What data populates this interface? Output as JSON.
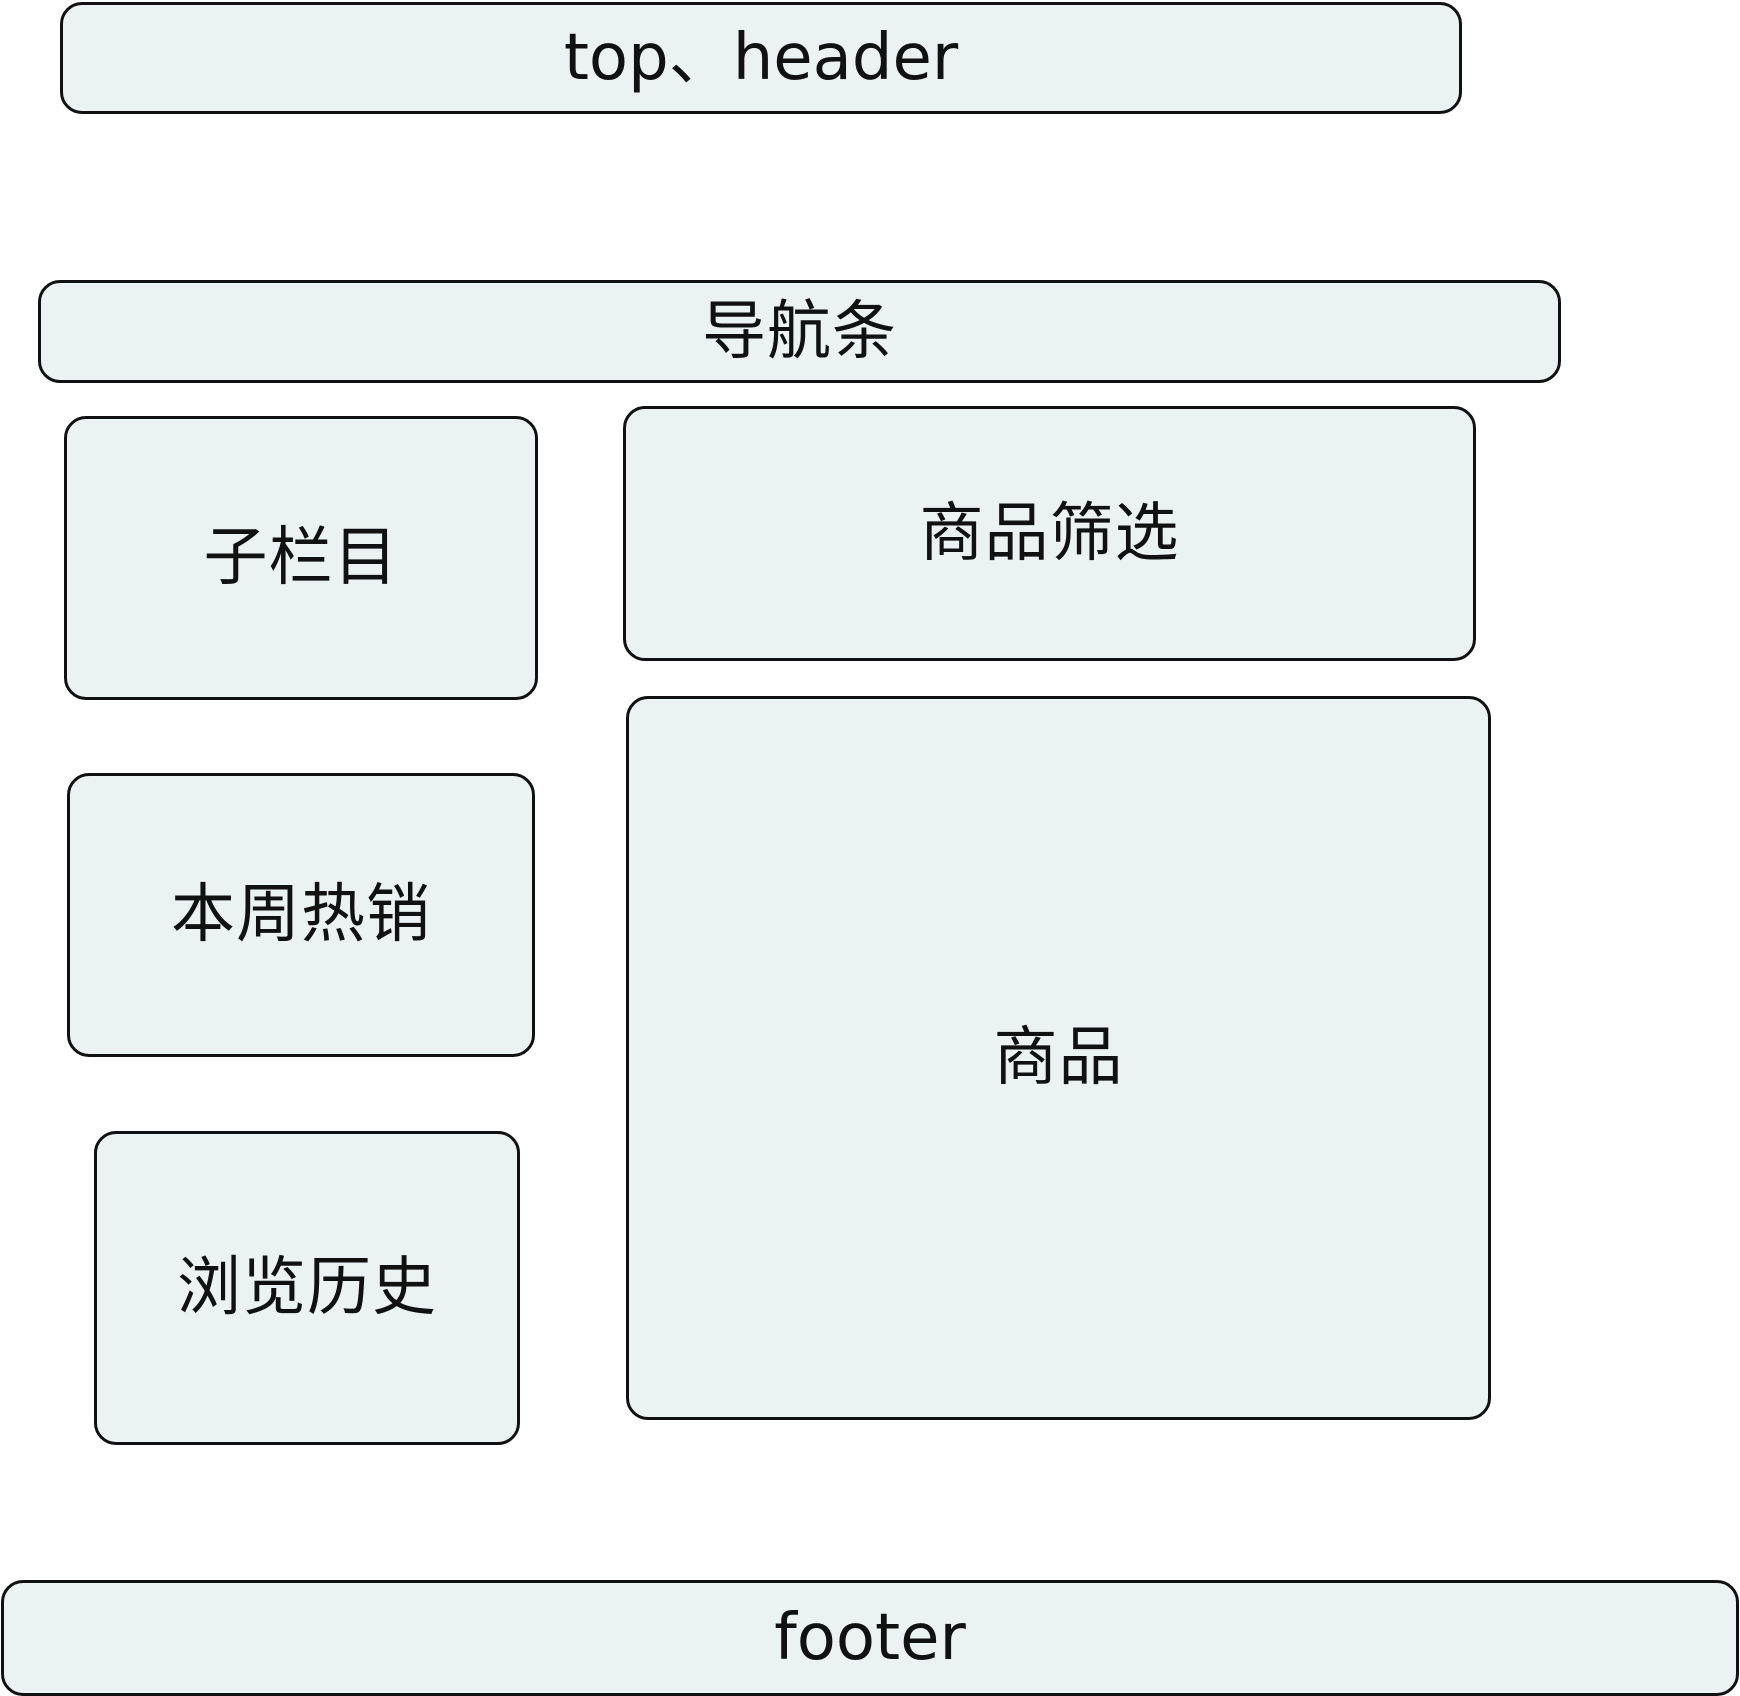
{
  "blocks": {
    "header": "top、header",
    "nav": "导航条",
    "sub_column": "子栏目",
    "weekly_hot": "本周热销",
    "history": "浏览历史",
    "filter": "商品筛选",
    "products": "商品",
    "footer": "footer"
  },
  "colors": {
    "box_fill": "#ebf2f4",
    "box_border": "#111111",
    "background": "#ffffff"
  }
}
